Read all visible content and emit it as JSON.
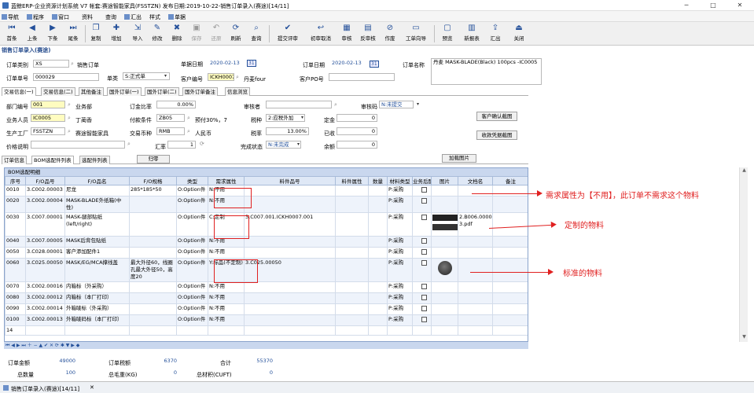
{
  "window": {
    "title": "蓝鲸ERP-企业资源计划系统 V7 帐套:赛途智能家具(FSSTZN) 发布日期:2019-10-22-销售订单录入(赛途)[14/11]",
    "min": "─",
    "max": "□",
    "close": "✕"
  },
  "menu": [
    {
      "label": "导航"
    },
    {
      "label": "程序"
    },
    {
      "label": "窗口"
    },
    {
      "label": "资料"
    },
    {
      "label": "查询"
    },
    {
      "label": "汇出"
    },
    {
      "label": "样式"
    },
    {
      "label": "单据"
    }
  ],
  "toolbar": [
    {
      "label": "首条",
      "icon": "⏮"
    },
    {
      "label": "上条",
      "icon": "◀"
    },
    {
      "label": "下条",
      "icon": "▶"
    },
    {
      "label": "尾条",
      "icon": "⏭"
    },
    {
      "label": "复制",
      "icon": "❐"
    },
    {
      "label": "增加",
      "icon": "✚"
    },
    {
      "label": "导入",
      "icon": "⇲"
    },
    {
      "label": "修改",
      "icon": "✎"
    },
    {
      "label": "删除",
      "icon": "✖"
    },
    {
      "label": "保存",
      "icon": "▣"
    },
    {
      "label": "还原",
      "icon": "↶"
    },
    {
      "label": "刷新",
      "icon": "⟳"
    },
    {
      "label": "查询",
      "icon": "⌕"
    },
    {
      "label": "提交评审",
      "icon": "✔"
    },
    {
      "label": "初审取消",
      "icon": "↩"
    },
    {
      "label": "审核",
      "icon": "▦"
    },
    {
      "label": "反审核",
      "icon": "▤"
    },
    {
      "label": "作废",
      "icon": "⊘"
    },
    {
      "label": "工单向导",
      "icon": "▭"
    },
    {
      "label": "预览",
      "icon": "▢"
    },
    {
      "label": "新报表",
      "icon": "▥"
    },
    {
      "label": "汇出",
      "icon": "⇪"
    },
    {
      "label": "关闭",
      "icon": "⏏"
    }
  ],
  "page_heading": "销售订单录入(赛途)",
  "header": {
    "order_type_label": "订单类别",
    "order_type": "XS",
    "order_type_name": "销售订单",
    "doc_date_label": "单据日期",
    "doc_date": "2020-02-13",
    "order_date_label": "订单日期",
    "order_date": "2020-02-13",
    "order_name_label": "订单名称",
    "order_name": "丹麦 MASK-BLADE(Black) 100pcs  -IC0005",
    "order_no_label": "订单单号",
    "order_no": "000029",
    "class_label": "单类",
    "class_value": "S:正式单",
    "cust_no_label": "客户编号",
    "cust_no": "ICKH0007",
    "cust_name": "丹麦four",
    "cust_po_label": "客户PO号",
    "cal_icon": "31"
  },
  "info_tabs": [
    "交易信息(一)",
    "交易信息(二)",
    "其他备注",
    "国外订单(一)",
    "国外订单(二)",
    "国外订单备注",
    "信息浏览"
  ],
  "info": {
    "dept_label": "部门编号",
    "dept": "001",
    "dept_name": "业务部",
    "sales_label": "业务人员",
    "sales": "IC0005",
    "sales_name": "丁蔺香",
    "factory_label": "生产工厂",
    "factory": "FSSTZN",
    "factory_name": "赛途智能家具",
    "price_desc_label": "价格说明",
    "deposit_label": "订金比率",
    "deposit": "0.00%",
    "payterm_label": "付款条件",
    "payterm": "ZB05",
    "payterm_desc": "预付30%，7",
    "currency_label": "交易币种",
    "currency": "RMB",
    "currency_name": "人民币",
    "rate_label": "汇率",
    "rate": "1",
    "reviewer_label": "审核者",
    "tax_label": "税种",
    "tax": "2:应税外加",
    "taxrate_label": "税率",
    "taxrate": "13.00%",
    "complete_label": "完成状态",
    "complete": "N:未完成",
    "audit_label": "审核码",
    "audit": "N:未提交",
    "deposit_amt_label": "定金",
    "deposit_amt": "0",
    "received_label": "已收",
    "received": "0",
    "balance_label": "余额",
    "balance": "0",
    "btn_cust_confirm": "客户确认截图",
    "btn_receipt": "收款凭据截图"
  },
  "sub_tabs": [
    "订单信息",
    "BOM选配件列表",
    "选配件列表"
  ],
  "btn_return": "归零",
  "btn_add_image": "加载图片",
  "grid": {
    "caption": "BOM选配明细",
    "columns": [
      "序号",
      "F/O品号",
      "F/O品名",
      "F/O规格",
      "类型",
      "需求属性",
      "料件品号",
      "料件属性",
      "数量",
      "材料类型",
      "业务后配",
      "图片",
      "文档名",
      "备注"
    ],
    "rows": [
      {
        "seq": "0010",
        "code": "3.C002.00003",
        "name": "尼龙",
        "spec": "285*185*50",
        "type": "O:Option件",
        "req": "N:不用",
        "part": "",
        "mtype": "P:采购"
      },
      {
        "seq": "0020",
        "code": "3.C002.00004",
        "name": "MASK-BLADE外纸箱(中性)",
        "spec": "",
        "type": "O:Option件",
        "req": "N:不用",
        "part": "",
        "mtype": "P:采购"
      },
      {
        "seq": "0030",
        "code": "3.C007.00001",
        "name": "MASK-腿部贴纸(left/right)",
        "spec": "",
        "type": "O:Option件",
        "req": "C:定制",
        "part": "3.C007.001.ICKH0007.001",
        "mtype": "P:采购",
        "doc": "2.B006.0000100000 3.pdf"
      },
      {
        "seq": "0040",
        "code": "3.C007.00005",
        "name": "MASK后背包贴纸",
        "spec": "",
        "type": "O:Option件",
        "req": "N:不用",
        "part": "",
        "mtype": "P:采购"
      },
      {
        "seq": "0050",
        "code": "3.C028.00001",
        "name": "客户添加配件1",
        "spec": "",
        "type": "O:Option件",
        "req": "N:不用",
        "part": "",
        "mtype": "P:采购"
      },
      {
        "seq": "0060",
        "code": "3.C025.00050",
        "name": "MASK/EG/MCA撑线盖",
        "spec": "最大外径60，线圈孔最大外径50，高度20",
        "type": "O:Option件",
        "req": "Y:标品(不定制)",
        "part": "3.C025.00050",
        "mtype": "P:采购"
      },
      {
        "seq": "0070",
        "code": "3.C002.00016",
        "name": "内箱标（外采购）",
        "spec": "",
        "type": "O:Option件",
        "req": "N:不用",
        "part": "",
        "mtype": "P:采购"
      },
      {
        "seq": "0080",
        "code": "3.C002.00012",
        "name": "内箱标（本厂打印）",
        "spec": "",
        "type": "O:Option件",
        "req": "N:不用",
        "part": "",
        "mtype": "P:采购"
      },
      {
        "seq": "0090",
        "code": "3.C002.00014",
        "name": "外箱唛标（外采购）",
        "spec": "",
        "type": "O:Option件",
        "req": "N:不用",
        "part": "",
        "mtype": "P:采购"
      },
      {
        "seq": "0100",
        "code": "3.C002.00013",
        "name": "外箱唛码标（本厂打印）",
        "spec": "",
        "type": "O:Option件",
        "req": "N:不用",
        "part": "",
        "mtype": "P:采购"
      }
    ],
    "count": "14",
    "nav_icons": "⏮ ◀ ▶ ⏭ ＋ − ▲ ✔ ✕ ⟳ ✱ ▼ ▶ ◆"
  },
  "notes": [
    {
      "text": "需求属性为【不用】，此订单不需求这个物料"
    },
    {
      "text": "定制的物料"
    },
    {
      "text": "标准的物料"
    }
  ],
  "totals": {
    "amount_label": "订单金额",
    "amount": "49000",
    "tax_label": "订单税额",
    "tax": "6370",
    "total_label": "合计",
    "total": "55370",
    "qty_label": "总数量",
    "qty": "100",
    "weight_label": "总毛重(KG)",
    "weight": "0",
    "volume_label": "总材积(CUFT)",
    "volume": "0"
  },
  "statusbar": {
    "task": "销售订单录入(赛途)[14/11]",
    "close": "✕"
  }
}
